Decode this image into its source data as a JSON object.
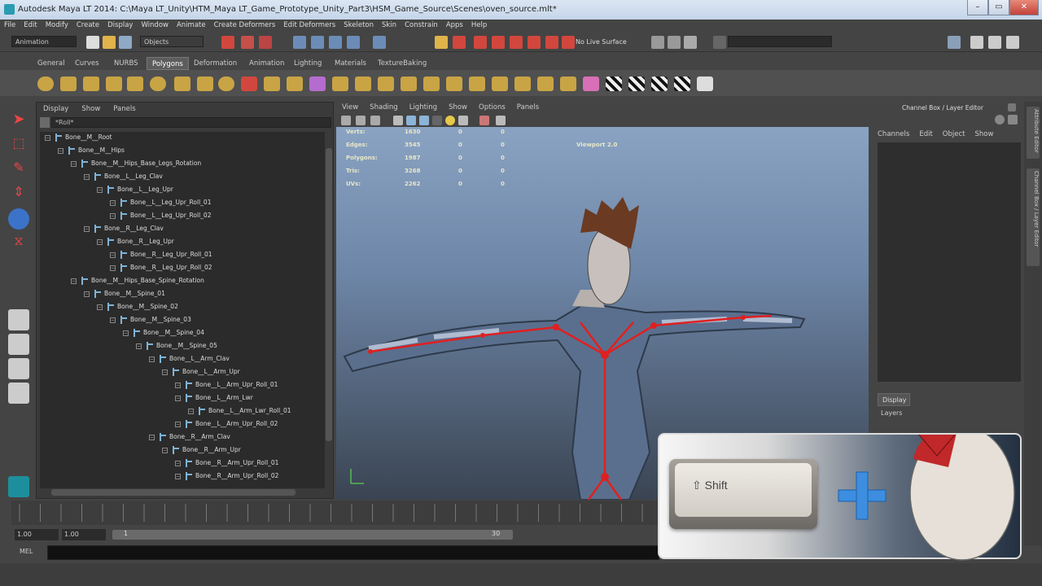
{
  "window": {
    "title": "Autodesk Maya LT 2014: C:\\Maya LT_Unity\\HTM_Maya LT_Game_Prototype_Unity_Part3\\HSM_Game_Source\\Scenes\\oven_source.mlt*"
  },
  "menubar": [
    "File",
    "Edit",
    "Modify",
    "Create",
    "Display",
    "Window",
    "Animate",
    "Create Deformers",
    "Edit Deformers",
    "Skeleton",
    "Skin",
    "Constrain",
    "Apps",
    "Help"
  ],
  "status": {
    "menuset": "Animation",
    "objects_label": "Objects",
    "live_surface": "No Live Surface"
  },
  "shelf_tabs": [
    "General",
    "Curves",
    "NURBS",
    "Polygons",
    "Deformation",
    "Animation",
    "Lighting",
    "Materials",
    "TextureBaking"
  ],
  "shelf_active": "Polygons",
  "outliner": {
    "menu": [
      "Display",
      "Show",
      "Panels"
    ],
    "filter": "*Roll*",
    "rows": [
      {
        "label": "Bone__M__Root",
        "depth": 0
      },
      {
        "label": "Bone__M__Hips",
        "depth": 1
      },
      {
        "label": "Bone__M__Hips_Base_Legs_Rotation",
        "depth": 2
      },
      {
        "label": "Bone__L__Leg_Clav",
        "depth": 3
      },
      {
        "label": "Bone__L__Leg_Upr",
        "depth": 4
      },
      {
        "label": "Bone__L__Leg_Upr_Roll_01",
        "depth": 5
      },
      {
        "label": "Bone__L__Leg_Upr_Roll_02",
        "depth": 5
      },
      {
        "label": "Bone__R__Leg_Clav",
        "depth": 3
      },
      {
        "label": "Bone__R__Leg_Upr",
        "depth": 4
      },
      {
        "label": "Bone__R__Leg_Upr_Roll_01",
        "depth": 5
      },
      {
        "label": "Bone__R__Leg_Upr_Roll_02",
        "depth": 5
      },
      {
        "label": "Bone__M__Hips_Base_Spine_Rotation",
        "depth": 2
      },
      {
        "label": "Bone__M__Spine_01",
        "depth": 3
      },
      {
        "label": "Bone__M__Spine_02",
        "depth": 4
      },
      {
        "label": "Bone__M__Spine_03",
        "depth": 5
      },
      {
        "label": "Bone__M__Spine_04",
        "depth": 6
      },
      {
        "label": "Bone__M__Spine_05",
        "depth": 7
      },
      {
        "label": "Bone__L__Arm_Clav",
        "depth": 8
      },
      {
        "label": "Bone__L__Arm_Upr",
        "depth": 9
      },
      {
        "label": "Bone__L__Arm_Upr_Roll_01",
        "depth": 10
      },
      {
        "label": "Bone__L__Arm_Lwr",
        "depth": 10
      },
      {
        "label": "Bone__L__Arm_Lwr_Roll_01",
        "depth": 11
      },
      {
        "label": "Bone__L__Arm_Upr_Roll_02",
        "depth": 10
      },
      {
        "label": "Bone__R__Arm_Clav",
        "depth": 8
      },
      {
        "label": "Bone__R__Arm_Upr",
        "depth": 9
      },
      {
        "label": "Bone__R__Arm_Upr_Roll_01",
        "depth": 10
      },
      {
        "label": "Bone__R__Arm_Upr_Roll_02",
        "depth": 10
      }
    ]
  },
  "viewport": {
    "menu": [
      "View",
      "Shading",
      "Lighting",
      "Show",
      "Options",
      "Panels"
    ],
    "hud": [
      {
        "label": "Verts:",
        "v1": "1630",
        "v2": "0",
        "v3": "0"
      },
      {
        "label": "Edges:",
        "v1": "3545",
        "v2": "0",
        "v3": "0"
      },
      {
        "label": "Polygons:",
        "v1": "1987",
        "v2": "0",
        "v3": "0"
      },
      {
        "label": "Tris:",
        "v1": "3268",
        "v2": "0",
        "v3": "0"
      },
      {
        "label": "UVs:",
        "v1": "2262",
        "v2": "0",
        "v3": "0"
      }
    ],
    "renderer": "Viewport 2.0"
  },
  "channelbox": {
    "header": "Channel Box / Layer Editor",
    "menu": [
      "Channels",
      "Edit",
      "Object",
      "Show"
    ],
    "display_tab": "Display",
    "layers": "Layers"
  },
  "side_tabs": [
    "Attribute Editor",
    "Channel Box / Layer Editor"
  ],
  "timeline": {
    "start_field": "1.00",
    "start_field2": "1.00",
    "range_start": "1",
    "range_end": "30"
  },
  "cmdline": {
    "lang": "MEL"
  },
  "overlay": {
    "key_label": "Shift"
  }
}
